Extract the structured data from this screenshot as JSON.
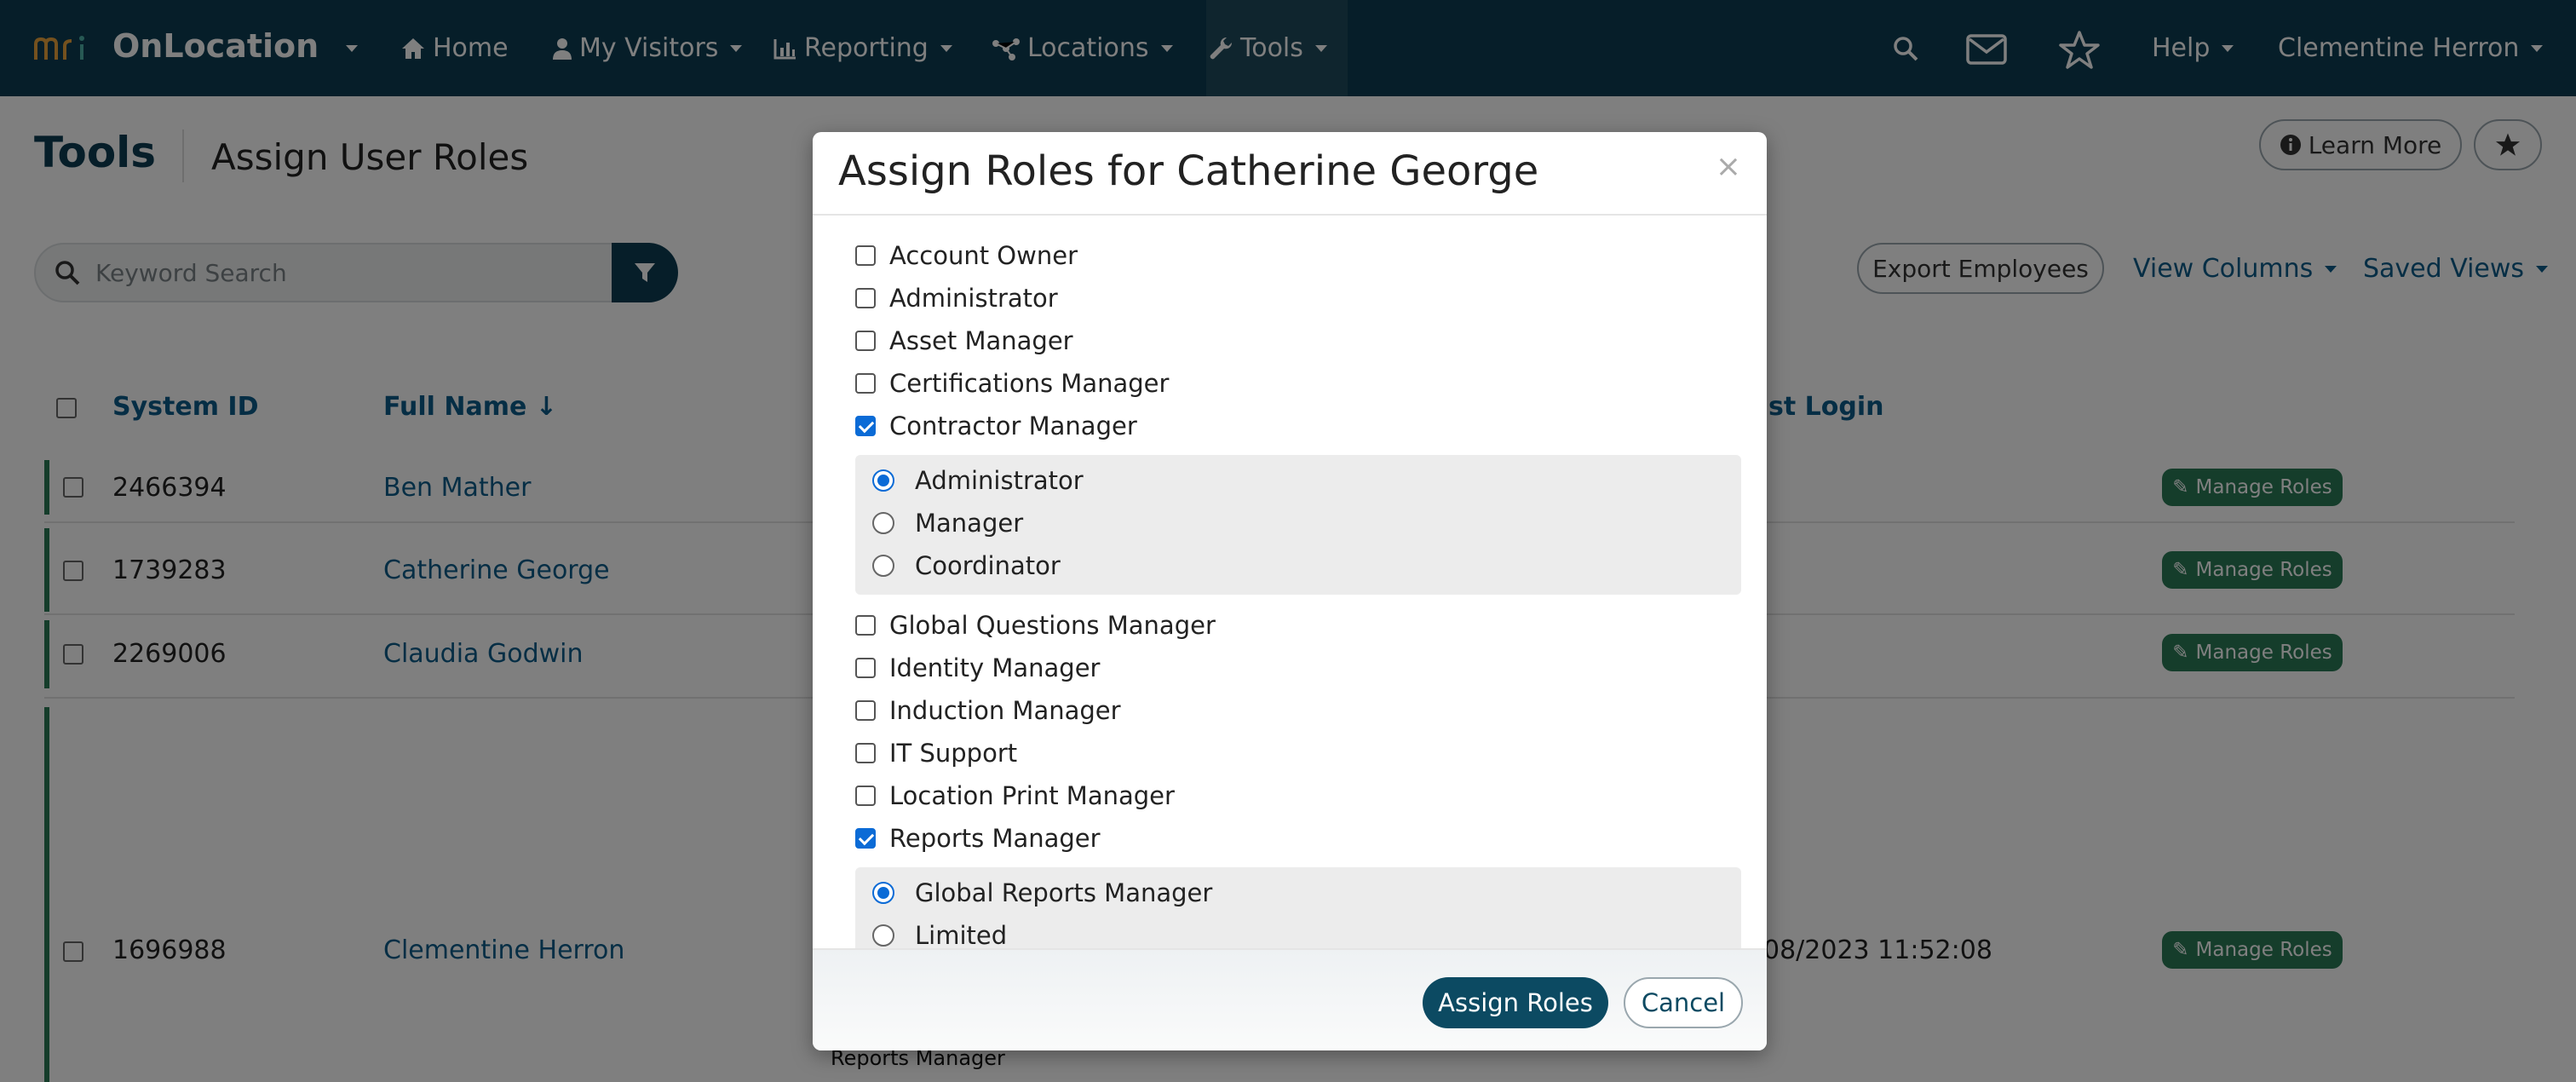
{
  "nav": {
    "brand": "OnLocation",
    "home": "Home",
    "my_visitors": "My Visitors",
    "reporting": "Reporting",
    "locations": "Locations",
    "tools": "Tools",
    "help": "Help",
    "user": "Clementine Herron"
  },
  "page": {
    "title": "Tools",
    "subtitle": "Assign User Roles",
    "learn_more": "Learn More",
    "search_placeholder": "Keyword Search",
    "export": "Export Employees",
    "view_columns": "View Columns",
    "saved_views": "Saved Views"
  },
  "table": {
    "headers": {
      "system_id": "System ID",
      "full_name": "Full Name ↓",
      "last_login": "st Login"
    },
    "manage_label": "Manage Roles",
    "rows": [
      {
        "id": "2466394",
        "name": "Ben Mather",
        "last_login": ""
      },
      {
        "id": "1739283",
        "name": "Catherine George",
        "last_login": ""
      },
      {
        "id": "2269006",
        "name": "Claudia Godwin",
        "last_login": ""
      },
      {
        "id": "1696988",
        "name": "Clementine Herron",
        "last_login": "08/2023 11:52:08"
      }
    ],
    "below_modal_text": "Reports Manager"
  },
  "modal": {
    "title": "Assign Roles for Catherine George",
    "close": "×",
    "roles": [
      {
        "label": "Account Owner",
        "checked": false
      },
      {
        "label": "Administrator",
        "checked": false
      },
      {
        "label": "Asset Manager",
        "checked": false
      },
      {
        "label": "Certifications Manager",
        "checked": false
      },
      {
        "label": "Contractor Manager",
        "checked": true
      },
      {
        "label": "Global Questions Manager",
        "checked": false
      },
      {
        "label": "Identity Manager",
        "checked": false
      },
      {
        "label": "Induction Manager",
        "checked": false
      },
      {
        "label": "IT Support",
        "checked": false
      },
      {
        "label": "Location Print Manager",
        "checked": false
      },
      {
        "label": "Reports Manager",
        "checked": true
      }
    ],
    "contractor_options": [
      {
        "label": "Administrator",
        "selected": true
      },
      {
        "label": "Manager",
        "selected": false
      },
      {
        "label": "Coordinator",
        "selected": false
      }
    ],
    "reports_options": [
      {
        "label": "Global Reports Manager",
        "selected": true
      },
      {
        "label": "Limited",
        "selected": false
      }
    ],
    "assign_button": "Assign Roles",
    "cancel_button": "Cancel"
  },
  "colors": {
    "navbar": "#0c3d52",
    "accent_green": "#2a7a56",
    "link_blue": "#0c5d8a",
    "checkbox_blue": "#0b6bd6"
  }
}
